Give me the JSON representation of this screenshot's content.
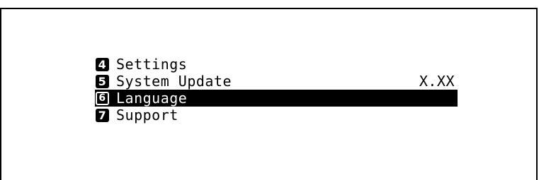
{
  "menu": {
    "items": [
      {
        "number": "4",
        "label": "Settings",
        "value": ""
      },
      {
        "number": "5",
        "label": "System Update",
        "value": "X.XX"
      },
      {
        "number": "6",
        "label": "Language",
        "value": ""
      },
      {
        "number": "7",
        "label": "Support",
        "value": ""
      }
    ],
    "selected_index": 2
  }
}
